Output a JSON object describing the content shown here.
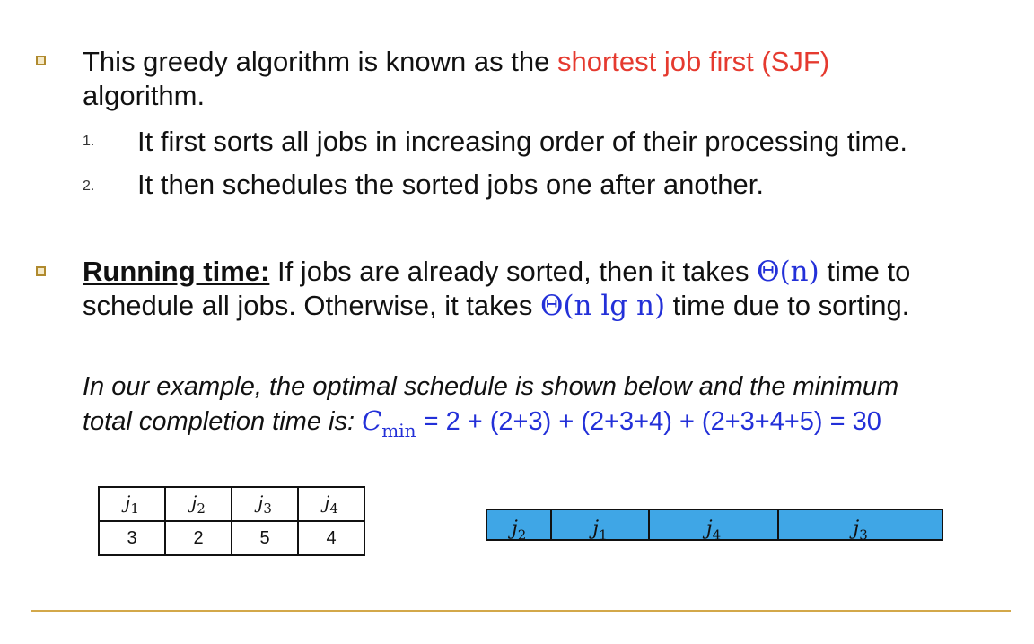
{
  "bullet1": {
    "text_a": "This greedy algorithm is known as the ",
    "highlight": "shortest job first (SJF)",
    "text_b": "algorithm."
  },
  "steps": [
    {
      "num": "1.",
      "text": "It first sorts all jobs in increasing order of their processing time."
    },
    {
      "num": "2.",
      "text": "It then schedules the sorted jobs one after another."
    }
  ],
  "bullet2": {
    "heading": "Running time:",
    "text_a": " If jobs are already sorted, then it takes ",
    "math_1": "Θ(n)",
    "text_b": " time to",
    "text_c": "schedule all jobs. Otherwise, it takes ",
    "math_2": "Θ(n lg n)",
    "text_d": " time due to sorting."
  },
  "example": {
    "line1": "In our example, the optimal schedule is shown below and the minimum",
    "line2_a": "total completion time is: ",
    "cmin_symbol": "C",
    "cmin_sub": "min",
    "formula": " = 2 + (2+3) + (2+3+4) + (2+3+4+5) = 30"
  },
  "jobs_table": {
    "headers": [
      "j1",
      "j2",
      "j3",
      "j4"
    ],
    "values": [
      "3",
      "2",
      "5",
      "4"
    ]
  },
  "schedule": {
    "segments": [
      {
        "label": "j2",
        "duration": 2
      },
      {
        "label": "j1",
        "duration": 3
      },
      {
        "label": "j4",
        "duration": 4
      },
      {
        "label": "j3",
        "duration": 5
      }
    ]
  },
  "colors": {
    "highlight": "#e53a2f",
    "math": "#2330d8",
    "bar": "#3fa6e6",
    "rule": "#d3a84a"
  }
}
